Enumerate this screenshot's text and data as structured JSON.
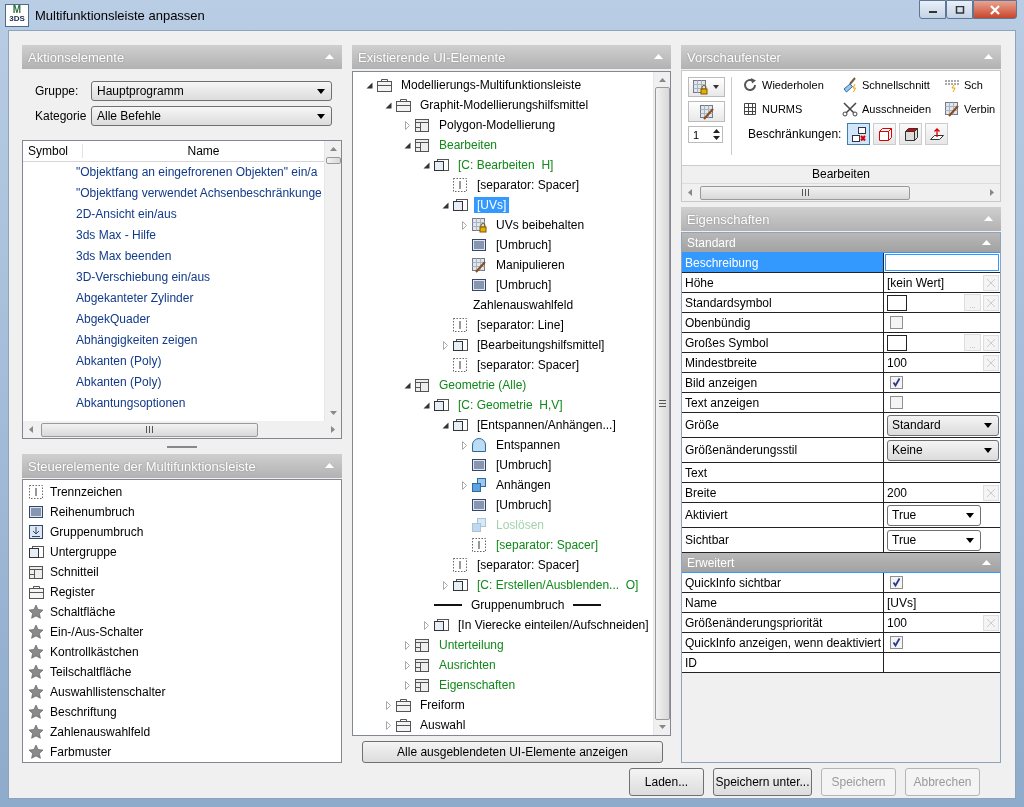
{
  "window": {
    "title": "Multifunktionsleiste anpassen",
    "logo": [
      "M",
      "3DS"
    ]
  },
  "action_items": {
    "title": "Aktionselemente",
    "expanded": true,
    "group_label": "Gruppe:",
    "group_value": "Hauptprogramm",
    "category_label": "Kategorie",
    "category_value": "Alle Befehle",
    "columns": [
      "Symbol",
      "Name"
    ],
    "items": [
      "\"Objektfang an eingefrorenen Objekten\" ein/a",
      "\"Objektfang verwendet Achsenbeschränkunge",
      "2D-Ansicht ein/aus",
      "3ds Max - Hilfe",
      "3ds Max beenden",
      "3D-Verschiebung ein/aus",
      "Abgekanteter Zylinder",
      "AbgekQuader",
      "Abhängigkeiten zeigen",
      "Abkanten (Poly)",
      "Abkanten (Poly)",
      "Abkantungsoptionen"
    ]
  },
  "controls_panel": {
    "title": "Steuerelemente der Multifunktionsleiste",
    "expanded": true,
    "items": [
      {
        "label": "Trennzeichen",
        "kind": "separator"
      },
      {
        "label": "Reihenumbruch",
        "kind": "break"
      },
      {
        "label": "Gruppenumbruch",
        "kind": "arrowbox"
      },
      {
        "label": "Untergruppe",
        "kind": "subpanel"
      },
      {
        "label": "Schnitteil",
        "kind": "panel"
      },
      {
        "label": "Register",
        "kind": "tab"
      },
      {
        "label": "Schaltfläche",
        "kind": "star"
      },
      {
        "label": "Ein-/Aus-Schalter",
        "kind": "star"
      },
      {
        "label": "Kontrollkästchen",
        "kind": "star"
      },
      {
        "label": "Teilschaltfläche",
        "kind": "star"
      },
      {
        "label": "Auswahllistenschalter",
        "kind": "star"
      },
      {
        "label": "Beschriftung",
        "kind": "star"
      },
      {
        "label": "Zahlenauswahlfeld",
        "kind": "star"
      },
      {
        "label": "Farbmuster",
        "kind": "star"
      }
    ]
  },
  "tree_panel": {
    "title": "Existierende UI-Elemente",
    "expanded": true,
    "show_hidden_button": "Alle ausgeblendeten UI-Elemente anzeigen",
    "tree": [
      {
        "label": "Modellierungs-Multifunktionsleiste",
        "kind": "tab",
        "color": "#000000",
        "selected": false,
        "expanded": true,
        "children": [
          {
            "label": "Graphit-Modellierungshilfsmittel",
            "kind": "tab",
            "color": "#000000",
            "selected": false,
            "expanded": true,
            "children": [
              {
                "label": "Polygon-Modellierung",
                "kind": "panel",
                "color": "#000000",
                "selected": false,
                "expanded": false
              },
              {
                "label": "Bearbeiten",
                "kind": "panel",
                "color": "#11881a",
                "selected": false,
                "expanded": true,
                "children": [
                  {
                    "label": "[C: Bearbeiten  H]",
                    "kind": "subpanel",
                    "color": "#11881a",
                    "selected": false,
                    "expanded": true,
                    "children": [
                      {
                        "label": "[separator: Spacer]",
                        "kind": "separator",
                        "color": "#000000",
                        "selected": false
                      },
                      {
                        "label": "[UVs]",
                        "kind": "subpanel",
                        "selected": true,
                        "expanded": true,
                        "children": [
                          {
                            "label": "UVs beibehalten",
                            "kind": "lockgrid",
                            "color": "#000000",
                            "selected": false,
                            "expanded": false
                          },
                          {
                            "label": "[Umbruch]",
                            "kind": "break",
                            "color": "#000000",
                            "selected": false
                          },
                          {
                            "label": "Manipulieren",
                            "kind": "brushgrid",
                            "color": "#000000",
                            "selected": false
                          },
                          {
                            "label": "[Umbruch]",
                            "kind": "break",
                            "color": "#000000",
                            "selected": false
                          },
                          {
                            "label": "Zahlenauswahlfeld",
                            "kind": "none",
                            "color": "#000000",
                            "selected": false
                          }
                        ]
                      },
                      {
                        "label": "[separator: Line]",
                        "kind": "separator",
                        "color": "#000000",
                        "selected": false
                      },
                      {
                        "label": "[Bearbeitungshilfsmittel]",
                        "kind": "subpanel",
                        "color": "#000000",
                        "selected": false,
                        "expanded": false
                      },
                      {
                        "label": "[separator: Spacer]",
                        "kind": "separator",
                        "color": "#000000",
                        "selected": false
                      }
                    ]
                  }
                ]
              },
              {
                "label": "Geometrie (Alle)",
                "kind": "panel",
                "color": "#11881a",
                "selected": false,
                "expanded": true,
                "children": [
                  {
                    "label": "[C: Geometrie  H,V]",
                    "kind": "subpanel",
                    "color": "#11881a",
                    "selected": false,
                    "expanded": true,
                    "children": [
                      {
                        "label": "[Entspannen/Anhängen...]",
                        "kind": "subpanel",
                        "color": "#000000",
                        "selected": false,
                        "expanded": true,
                        "children": [
                          {
                            "label": "Entspannen",
                            "kind": "dome",
                            "color": "#000000",
                            "selected": false,
                            "expanded": false
                          },
                          {
                            "label": "[Umbruch]",
                            "kind": "break",
                            "color": "#000000",
                            "selected": false
                          },
                          {
                            "label": "Anhängen",
                            "kind": "cubes",
                            "color": "#000000",
                            "selected": false,
                            "expanded": false
                          },
                          {
                            "label": "[Umbruch]",
                            "kind": "break",
                            "color": "#000000",
                            "selected": false
                          },
                          {
                            "label": "Loslösen",
                            "kind": "cubes",
                            "color": "#a3d3ad",
                            "selected": false,
                            "disabled": true
                          },
                          {
                            "label": "[separator: Spacer]",
                            "kind": "separator",
                            "color": "#11881a",
                            "selected": false
                          }
                        ]
                      },
                      {
                        "label": "[separator: Spacer]",
                        "kind": "separator",
                        "color": "#000000",
                        "selected": false
                      },
                      {
                        "label": "[C: Erstellen/Ausblenden...  O]",
                        "kind": "subpanel",
                        "color": "#11881a",
                        "selected": false,
                        "expanded": false
                      }
                    ]
                  },
                  {
                    "label": "Gruppenumbruch",
                    "kind": "groupbreak",
                    "color": "#000000",
                    "selected": false
                  },
                  {
                    "label": "[In Vierecke einteilen/Aufschneiden]",
                    "kind": "subpanel",
                    "color": "#000000",
                    "selected": false,
                    "expanded": false
                  }
                ]
              },
              {
                "label": "Unterteilung",
                "kind": "panel",
                "color": "#11881a",
                "selected": false,
                "expanded": false
              },
              {
                "label": "Ausrichten",
                "kind": "panel",
                "color": "#11881a",
                "selected": false,
                "expanded": false
              },
              {
                "label": "Eigenschaften",
                "kind": "panel",
                "color": "#11881a",
                "selected": false,
                "expanded": false
              }
            ]
          },
          {
            "label": "Freiform",
            "kind": "tab",
            "color": "#000000",
            "selected": false,
            "expanded": false
          },
          {
            "label": "Auswahl",
            "kind": "tab",
            "color": "#000000",
            "selected": false,
            "expanded": false
          }
        ]
      }
    ]
  },
  "preview": {
    "title": "Vorschaufenster",
    "expanded": true,
    "spinner_value": "1",
    "commands": [
      {
        "label": "Wiederholen",
        "kind": "refresh"
      },
      {
        "label": "Schnellschnitt",
        "kind": "knife"
      },
      {
        "label": "Sch",
        "kind": "slice"
      },
      {
        "label": "NURMS",
        "kind": "mesh"
      },
      {
        "label": "Ausschneiden",
        "kind": "scissors"
      },
      {
        "label": "Verbin",
        "kind": "brushgrid"
      }
    ],
    "constraints_label": "Beschränkungen:",
    "constraints": [
      {
        "kind": "c-none",
        "selected": true
      },
      {
        "kind": "c-edge",
        "selected": false
      },
      {
        "kind": "c-face",
        "selected": false
      },
      {
        "kind": "c-normal",
        "selected": false
      }
    ],
    "panel_label": "Bearbeiten"
  },
  "properties": {
    "title": "Eigenschaften",
    "expanded": true,
    "groups": [
      {
        "title": "Standard",
        "expanded": true,
        "rows": [
          {
            "label": "Beschreibung",
            "kind": "text",
            "selected": true
          },
          {
            "label": "Höhe",
            "kind": "text",
            "value": "[kein Wert]",
            "clearable": true,
            "selected": false
          },
          {
            "label": "Standardsymbol",
            "kind": "symbol",
            "browse_label": "...",
            "selected": false
          },
          {
            "label": "Obenbündig",
            "kind": "checkbox",
            "checked": false,
            "selected": false
          },
          {
            "label": "Großes Symbol",
            "kind": "symbol",
            "browse_label": "...",
            "selected": false
          },
          {
            "label": "Mindestbreite",
            "kind": "text",
            "value": "100",
            "clearable": true,
            "selected": false
          },
          {
            "label": "Bild anzeigen",
            "kind": "checkbox",
            "checked": true,
            "selected": false
          },
          {
            "label": "Text anzeigen",
            "kind": "checkbox",
            "checked": false,
            "selected": false
          },
          {
            "label": "Größe",
            "kind": "combo",
            "value": "Standard",
            "selected": false
          },
          {
            "label": "Größenänderungsstil",
            "kind": "combo",
            "value": "Keine",
            "selected": false
          },
          {
            "label": "Text",
            "kind": "text",
            "selected": false
          },
          {
            "label": "Breite",
            "kind": "text",
            "value": "200",
            "clearable": true,
            "selected": false
          },
          {
            "label": "Aktiviert",
            "kind": "dropdown",
            "value": "True",
            "selected": false
          },
          {
            "label": "Sichtbar",
            "kind": "dropdown",
            "value": "True",
            "selected": false
          }
        ]
      },
      {
        "title": "Erweitert",
        "expanded": true,
        "rows": [
          {
            "label": "QuickInfo sichtbar",
            "kind": "checkbox",
            "checked": true,
            "selected": false
          },
          {
            "label": "Name",
            "kind": "text",
            "value": "[UVs]",
            "selected": false
          },
          {
            "label": "Größenänderungspriorität",
            "kind": "text",
            "value": "100",
            "clearable": true,
            "selected": false
          },
          {
            "label": "QuickInfo anzeigen, wenn deaktiviert",
            "kind": "checkbox",
            "checked": true,
            "selected": false
          },
          {
            "label": "ID",
            "kind": "text",
            "selected": false
          }
        ]
      }
    ]
  },
  "buttons": [
    {
      "label": "Laden...",
      "disabled": false
    },
    {
      "label": "Speichern unter...",
      "disabled": false
    },
    {
      "label": "Speichern",
      "disabled": true
    },
    {
      "label": "Abbrechen",
      "disabled": true
    }
  ]
}
